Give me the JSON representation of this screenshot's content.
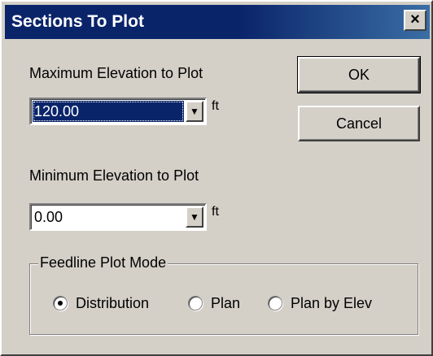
{
  "window": {
    "title": "Sections To Plot",
    "close_label": "×"
  },
  "max_elevation": {
    "label": "Maximum Elevation to Plot",
    "value": "120.00",
    "unit": "ft"
  },
  "min_elevation": {
    "label": "Minimum Elevation to Plot",
    "value": "0.00",
    "unit": "ft"
  },
  "buttons": {
    "ok": "OK",
    "cancel": "Cancel"
  },
  "feedline_mode": {
    "legend": "Feedline Plot Mode",
    "options": [
      {
        "label": "Distribution",
        "selected": true
      },
      {
        "label": "Plan",
        "selected": false
      },
      {
        "label": "Plan by Elev",
        "selected": false
      }
    ]
  },
  "icons": {
    "dropdown": "chevron-down-icon",
    "close": "close-icon"
  },
  "colors": {
    "titlebar": "#0a246a",
    "face": "#d4d0c8",
    "selection": "#0a246a"
  }
}
